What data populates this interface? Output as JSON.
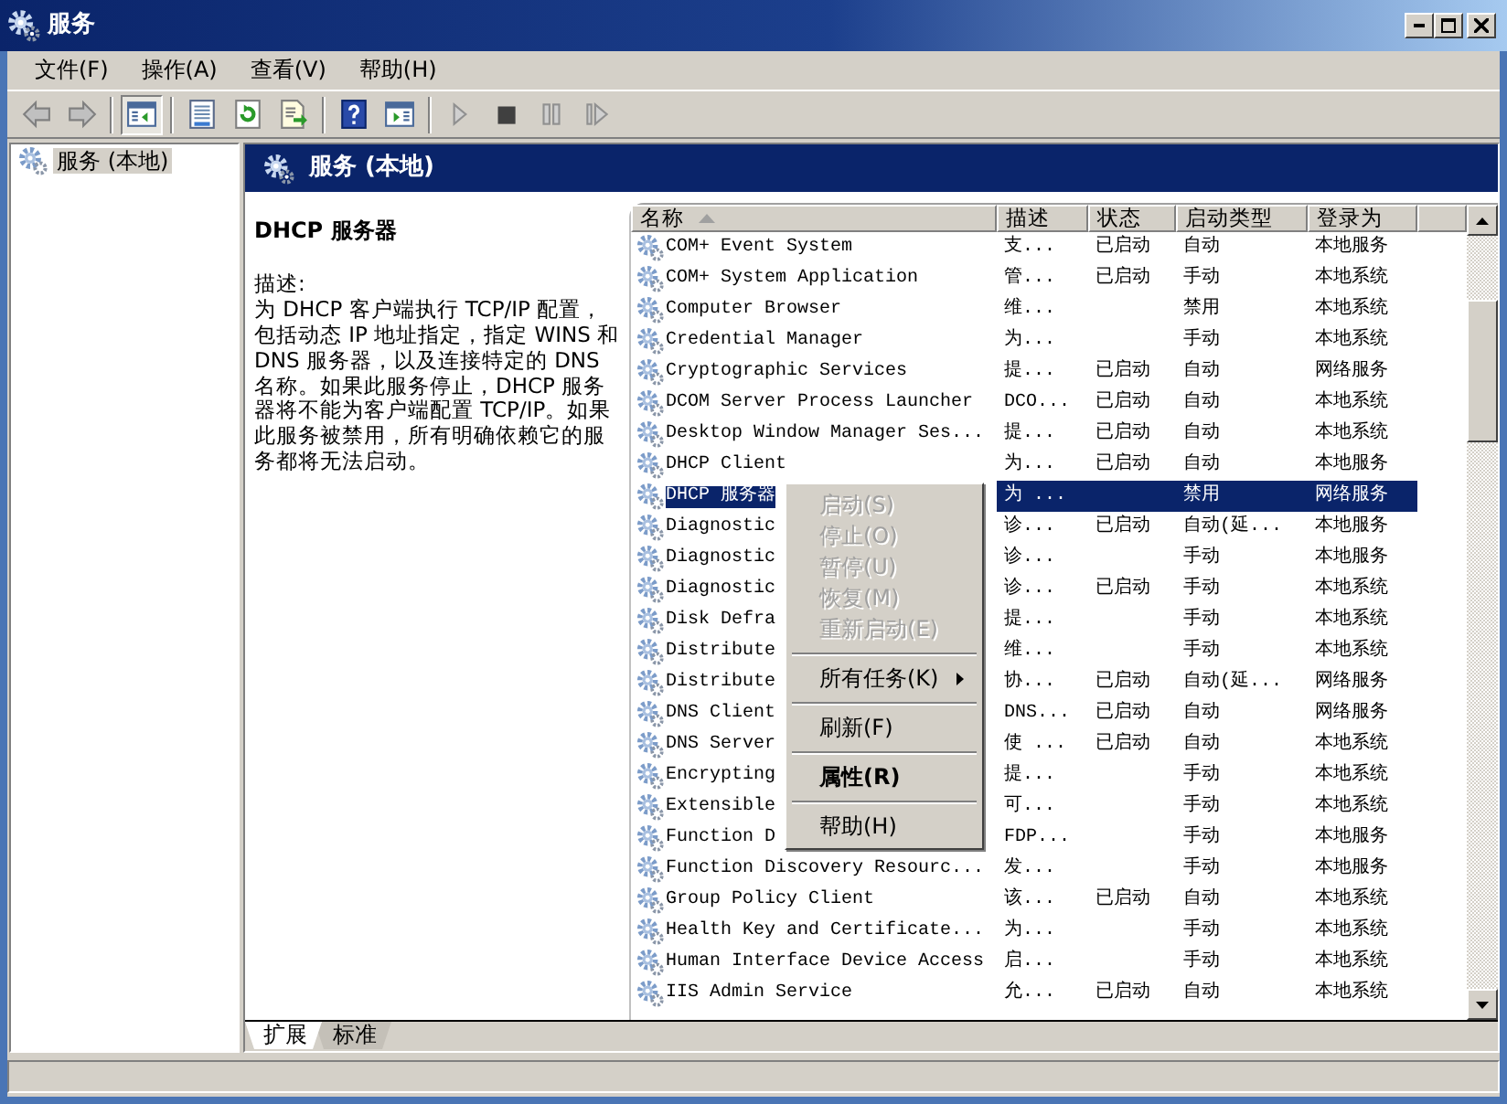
{
  "window": {
    "title": "服务"
  },
  "menu": [
    "文件(F)",
    "操作(A)",
    "查看(V)",
    "帮助(H)"
  ],
  "tree": {
    "items": [
      {
        "label": "服务 (本地)",
        "selected": true
      }
    ]
  },
  "panel_header": "服务 (本地)",
  "description": {
    "title": "DHCP 服务器",
    "label": "描述:",
    "text": "为 DHCP 客户端执行 TCP/IP 配置，包括动态 IP 地址指定，指定 WINS 和 DNS 服务器，以及连接特定的 DNS 名称。如果此服务停止，DHCP 服务器将不能为客户端配置 TCP/IP。如果此服务被禁用，所有明确依赖它的服务都将无法启动。"
  },
  "table": {
    "columns": [
      {
        "label": "名称",
        "sorted": true
      },
      {
        "label": "描述",
        "sorted": false
      },
      {
        "label": "状态",
        "sorted": false
      },
      {
        "label": "启动类型",
        "sorted": false
      },
      {
        "label": "登录为",
        "sorted": false
      }
    ],
    "rows": [
      {
        "name": "COM+ Event System",
        "description": "支...",
        "status": "已启动",
        "startup_type": "自动",
        "log_on_as": "本地服务",
        "selected": false
      },
      {
        "name": "COM+ System Application",
        "description": "管...",
        "status": "已启动",
        "startup_type": "手动",
        "log_on_as": "本地系统",
        "selected": false
      },
      {
        "name": "Computer Browser",
        "description": "维...",
        "status": "",
        "startup_type": "禁用",
        "log_on_as": "本地系统",
        "selected": false
      },
      {
        "name": "Credential Manager",
        "description": "为...",
        "status": "",
        "startup_type": "手动",
        "log_on_as": "本地系统",
        "selected": false
      },
      {
        "name": "Cryptographic Services",
        "description": "提...",
        "status": "已启动",
        "startup_type": "自动",
        "log_on_as": "网络服务",
        "selected": false
      },
      {
        "name": "DCOM Server Process Launcher",
        "description": "DCO...",
        "status": "已启动",
        "startup_type": "自动",
        "log_on_as": "本地系统",
        "selected": false
      },
      {
        "name": "Desktop Window Manager Ses...",
        "description": "提...",
        "status": "已启动",
        "startup_type": "自动",
        "log_on_as": "本地系统",
        "selected": false
      },
      {
        "name": "DHCP Client",
        "description": "为...",
        "status": "已启动",
        "startup_type": "自动",
        "log_on_as": "本地服务",
        "selected": false
      },
      {
        "name": "DHCP 服务器",
        "description": "为 ...",
        "status": "",
        "startup_type": "禁用",
        "log_on_as": "网络服务",
        "selected": true
      },
      {
        "name": "Diagnostic",
        "description": "诊...",
        "status": "已启动",
        "startup_type": "自动(延...",
        "log_on_as": "本地服务",
        "selected": false
      },
      {
        "name": "Diagnostic",
        "description": "诊...",
        "status": "",
        "startup_type": "手动",
        "log_on_as": "本地服务",
        "selected": false
      },
      {
        "name": "Diagnostic",
        "description": "诊...",
        "status": "已启动",
        "startup_type": "手动",
        "log_on_as": "本地系统",
        "selected": false
      },
      {
        "name": "Disk Defra",
        "description": "提...",
        "status": "",
        "startup_type": "手动",
        "log_on_as": "本地系统",
        "selected": false
      },
      {
        "name": "Distribute",
        "description": "维...",
        "status": "",
        "startup_type": "手动",
        "log_on_as": "本地系统",
        "selected": false
      },
      {
        "name": "Distribute",
        "description": "协...",
        "status": "已启动",
        "startup_type": "自动(延...",
        "log_on_as": "网络服务",
        "selected": false
      },
      {
        "name": "DNS Client",
        "description": "DNS...",
        "status": "已启动",
        "startup_type": "自动",
        "log_on_as": "网络服务",
        "selected": false
      },
      {
        "name": "DNS Server",
        "description": "使 ...",
        "status": "已启动",
        "startup_type": "自动",
        "log_on_as": "本地系统",
        "selected": false
      },
      {
        "name": "Encrypting",
        "description": "提...",
        "status": "",
        "startup_type": "手动",
        "log_on_as": "本地系统",
        "selected": false
      },
      {
        "name": "Extensible",
        "description": "可...",
        "status": "",
        "startup_type": "手动",
        "log_on_as": "本地系统",
        "selected": false
      },
      {
        "name": "Function D",
        "description": "FDP...",
        "status": "",
        "startup_type": "手动",
        "log_on_as": "本地服务",
        "selected": false
      },
      {
        "name": "Function Discovery Resourc...",
        "description": "发...",
        "status": "",
        "startup_type": "手动",
        "log_on_as": "本地服务",
        "selected": false
      },
      {
        "name": "Group Policy Client",
        "description": "该...",
        "status": "已启动",
        "startup_type": "自动",
        "log_on_as": "本地系统",
        "selected": false
      },
      {
        "name": "Health Key and Certificate...",
        "description": "为...",
        "status": "",
        "startup_type": "手动",
        "log_on_as": "本地系统",
        "selected": false
      },
      {
        "name": "Human Interface Device Access",
        "description": "启...",
        "status": "",
        "startup_type": "手动",
        "log_on_as": "本地系统",
        "selected": false
      },
      {
        "name": "IIS Admin Service",
        "description": "允...",
        "status": "已启动",
        "startup_type": "自动",
        "log_on_as": "本地系统",
        "selected": false
      }
    ]
  },
  "context_menu": {
    "items": [
      {
        "kind": "item",
        "label": "启动(S)",
        "disabled": true,
        "default": false,
        "submenu": false
      },
      {
        "kind": "item",
        "label": "停止(O)",
        "disabled": true,
        "default": false,
        "submenu": false
      },
      {
        "kind": "item",
        "label": "暂停(U)",
        "disabled": true,
        "default": false,
        "submenu": false
      },
      {
        "kind": "item",
        "label": "恢复(M)",
        "disabled": true,
        "default": false,
        "submenu": false
      },
      {
        "kind": "item",
        "label": "重新启动(E)",
        "disabled": true,
        "default": false,
        "submenu": false
      },
      {
        "kind": "separator"
      },
      {
        "kind": "item",
        "label": "所有任务(K)",
        "disabled": false,
        "default": false,
        "submenu": true
      },
      {
        "kind": "separator"
      },
      {
        "kind": "item",
        "label": "刷新(F)",
        "disabled": false,
        "default": false,
        "submenu": false
      },
      {
        "kind": "separator"
      },
      {
        "kind": "item",
        "label": "属性(R)",
        "disabled": false,
        "default": true,
        "submenu": false
      },
      {
        "kind": "separator"
      },
      {
        "kind": "item",
        "label": "帮助(H)",
        "disabled": false,
        "default": false,
        "submenu": false
      }
    ]
  },
  "tabs": [
    {
      "label": "扩展",
      "selected": true
    },
    {
      "label": "标准",
      "selected": false
    }
  ]
}
